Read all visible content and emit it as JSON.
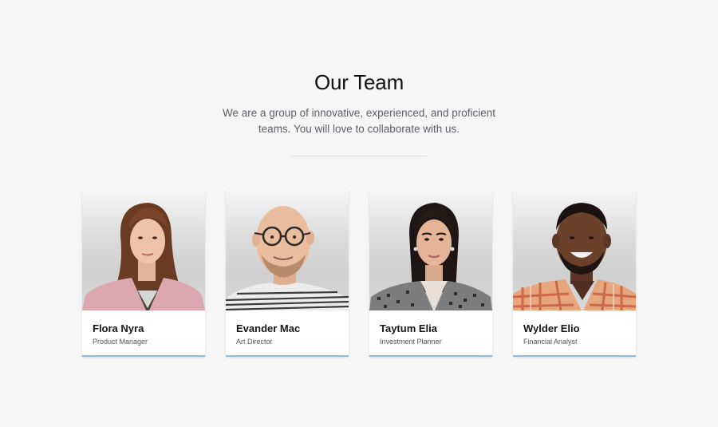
{
  "header": {
    "title": "Our Team",
    "subtitle_line1": "We are a group of innovative, experienced, and proficient",
    "subtitle_line2": "teams. You will love to collaborate with us."
  },
  "team": [
    {
      "name": "Flora Nyra",
      "role": "Product Manager",
      "photo": "woman-pink-blazer-portrait"
    },
    {
      "name": "Evander Mac",
      "role": "Art Director",
      "photo": "bald-man-glasses-striped-shirt-portrait"
    },
    {
      "name": "Taytum Elia",
      "role": "Investment Planner",
      "photo": "woman-ponytail-houndstooth-blazer-portrait"
    },
    {
      "name": "Wylder Elio",
      "role": "Financial Analyst",
      "photo": "man-plaid-shirt-smiling-portrait"
    }
  ],
  "colors": {
    "background": "#f6f6f7",
    "card_accent": "#8fbce6",
    "divider": "#dadcdf"
  }
}
